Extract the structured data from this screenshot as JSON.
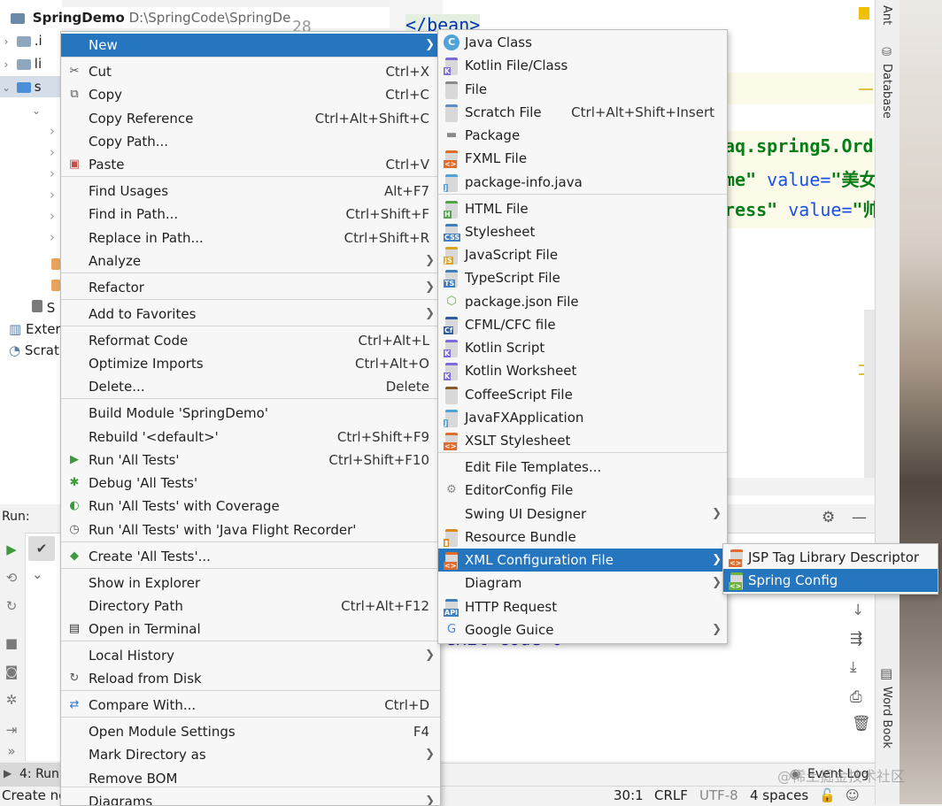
{
  "project": {
    "root_name": "SpringDemo",
    "root_path": "D:\\SpringCode\\SpringDe",
    "rows": [
      ".i",
      "li",
      "s",
      "S",
      "Exter",
      "Scrat"
    ]
  },
  "editor": {
    "line_no": "28",
    "tag_line": "</bean>",
    "code_1": "aq.spring5.Ord",
    "code_2a": "me\"",
    "code_2b": "value=",
    "code_2c": "\"美女",
    "code_3a": "ress\"",
    "code_3b": "value=",
    "code_3c": "\"帅"
  },
  "right_strip": {
    "ant": "Ant",
    "database": "Database",
    "word_book": "Word Book"
  },
  "run_panel": {
    "label": "Run:",
    "output": "exit code 0",
    "semicolon": ";"
  },
  "bottom_tabs": {
    "run_tab": "4: Run",
    "event_log": "Event Log"
  },
  "statusbar": {
    "left": "Create ne",
    "position": "30:1",
    "line_sep": "CRLF",
    "encoding": "UTF-8",
    "indent": "4 spaces"
  },
  "watermark": "@稀土掘金技术社区",
  "context_menu": [
    {
      "label": "New",
      "submenu": true,
      "selected": true
    },
    {
      "label": "Cut",
      "shortcut": "Ctrl+X",
      "icon": "scissors-icon"
    },
    {
      "label": "Copy",
      "shortcut": "Ctrl+C",
      "icon": "copy-icon"
    },
    {
      "label": "Copy Reference",
      "shortcut": "Ctrl+Alt+Shift+C"
    },
    {
      "label": "Copy Path...",
      "shortcut": ""
    },
    {
      "label": "Paste",
      "shortcut": "Ctrl+V",
      "icon": "clipboard-icon"
    },
    {
      "label": "Find Usages",
      "shortcut": "Alt+F7"
    },
    {
      "label": "Find in Path...",
      "shortcut": "Ctrl+Shift+F"
    },
    {
      "label": "Replace in Path...",
      "shortcut": "Ctrl+Shift+R"
    },
    {
      "label": "Analyze",
      "submenu": true
    },
    {
      "label": "Refactor",
      "submenu": true
    },
    {
      "label": "Add to Favorites",
      "submenu": true
    },
    {
      "label": "Reformat Code",
      "shortcut": "Ctrl+Alt+L"
    },
    {
      "label": "Optimize Imports",
      "shortcut": "Ctrl+Alt+O"
    },
    {
      "label": "Delete...",
      "shortcut": "Delete"
    },
    {
      "label": "Build Module 'SpringDemo'",
      "shortcut": ""
    },
    {
      "label": "Rebuild '<default>'",
      "shortcut": "Ctrl+Shift+F9"
    },
    {
      "label": "Run 'All Tests'",
      "shortcut": "Ctrl+Shift+F10",
      "icon": "run-icon"
    },
    {
      "label": "Debug 'All Tests'",
      "shortcut": "",
      "icon": "debug-icon"
    },
    {
      "label": "Run 'All Tests' with Coverage",
      "shortcut": "",
      "icon": "coverage-icon"
    },
    {
      "label": "Run 'All Tests' with 'Java Flight Recorder'",
      "shortcut": "",
      "icon": "flight-recorder-icon"
    },
    {
      "label": "Create 'All Tests'...",
      "shortcut": "",
      "icon": "create-test-icon"
    },
    {
      "label": "Show in Explorer",
      "shortcut": ""
    },
    {
      "label": "Directory Path",
      "shortcut": "Ctrl+Alt+F12"
    },
    {
      "label": "Open in Terminal",
      "shortcut": "",
      "icon": "terminal-icon"
    },
    {
      "label": "Local History",
      "submenu": true
    },
    {
      "label": "Reload from Disk",
      "shortcut": "",
      "icon": "reload-icon"
    },
    {
      "label": "Compare With...",
      "shortcut": "Ctrl+D",
      "icon": "compare-icon"
    },
    {
      "label": "Open Module Settings",
      "shortcut": "F4"
    },
    {
      "label": "Mark Directory as",
      "submenu": true
    },
    {
      "label": "Remove BOM",
      "shortcut": ""
    },
    {
      "label": "Diagrams",
      "submenu": true
    }
  ],
  "new_menu": [
    {
      "label": "Java Class",
      "icon": "java-class-icon"
    },
    {
      "label": "Kotlin File/Class",
      "icon": "kotlin-file-icon"
    },
    {
      "label": "File",
      "icon": "file-icon"
    },
    {
      "label": "Scratch File",
      "shortcut": "Ctrl+Alt+Shift+Insert",
      "icon": "scratch-file-icon"
    },
    {
      "label": "Package",
      "icon": "package-icon"
    },
    {
      "label": "FXML File",
      "icon": "fxml-file-icon"
    },
    {
      "label": "package-info.java",
      "icon": "java-file-icon"
    },
    {
      "label": "HTML File",
      "icon": "html-file-icon"
    },
    {
      "label": "Stylesheet",
      "icon": "css-file-icon"
    },
    {
      "label": "JavaScript File",
      "icon": "js-file-icon"
    },
    {
      "label": "TypeScript File",
      "icon": "ts-file-icon"
    },
    {
      "label": "package.json File",
      "icon": "nodejs-icon"
    },
    {
      "label": "CFML/CFC file",
      "icon": "cfml-icon"
    },
    {
      "label": "Kotlin Script",
      "icon": "kotlin-script-icon"
    },
    {
      "label": "Kotlin Worksheet",
      "icon": "kotlin-worksheet-icon"
    },
    {
      "label": "CoffeeScript File",
      "icon": "coffeescript-icon"
    },
    {
      "label": "JavaFXApplication",
      "icon": "javafx-icon"
    },
    {
      "label": "XSLT Stylesheet",
      "icon": "xslt-icon"
    },
    {
      "label": "Edit File Templates...",
      "icon": ""
    },
    {
      "label": "EditorConfig File",
      "icon": "gear-icon"
    },
    {
      "label": "Swing UI Designer",
      "submenu": true
    },
    {
      "label": "Resource Bundle",
      "icon": "resource-bundle-icon"
    },
    {
      "label": "XML Configuration File",
      "submenu": true,
      "selected": true,
      "icon": "xml-config-icon"
    },
    {
      "label": "Diagram",
      "submenu": true
    },
    {
      "label": "HTTP Request",
      "icon": "api-icon"
    },
    {
      "label": "Google Guice",
      "submenu": true,
      "icon": "google-icon"
    }
  ],
  "xml_menu": [
    {
      "label": "JSP Tag Library Descriptor",
      "icon": "xml-file-icon"
    },
    {
      "label": "Spring Config",
      "selected": true,
      "icon": "spring-config-icon"
    }
  ],
  "colors": {
    "selection": "#2675bf",
    "menu_bg": "#f7f7f7",
    "string_green": "#067d17",
    "keyword_blue": "#0033b3",
    "output_blue": "#1a1aa6"
  }
}
